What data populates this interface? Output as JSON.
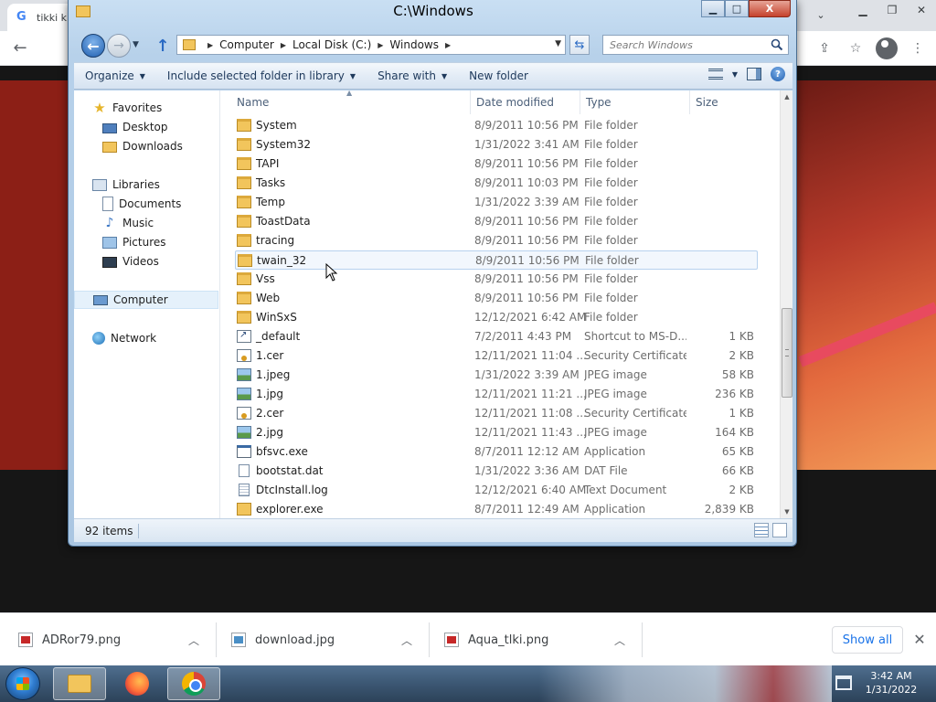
{
  "chrome": {
    "tabs": [
      {
        "title": "tikki k",
        "favicon": "google-g-icon",
        "active": true
      },
      {
        "title": "",
        "favicon": "green-square-icon",
        "active": false
      }
    ],
    "toolbar_icons": [
      "share-icon",
      "star-icon",
      "profile-avatar-icon",
      "menu-dots-icon"
    ]
  },
  "explorer": {
    "title": "C:\\Windows",
    "window_controls": {
      "minimize": "▁",
      "maximize": "□",
      "close": "X"
    },
    "breadcrumb": [
      "Computer",
      "Local Disk (C:)",
      "Windows"
    ],
    "search_placeholder": "Search Windows",
    "command_bar": {
      "organize": "Organize",
      "include_library": "Include selected folder in library",
      "share_with": "Share with",
      "new_folder": "New folder"
    },
    "nav_pane": {
      "favorites": {
        "label": "Favorites",
        "items": [
          "Desktop",
          "Downloads"
        ]
      },
      "libraries": {
        "label": "Libraries",
        "items": [
          "Documents",
          "Music",
          "Pictures",
          "Videos"
        ]
      },
      "computer": "Computer",
      "network": "Network"
    },
    "columns": {
      "name": "Name",
      "date": "Date modified",
      "type": "Type",
      "size": "Size"
    },
    "files": [
      {
        "name": "System",
        "date": "8/9/2011 10:56 PM",
        "type": "File folder",
        "size": "",
        "icon": "folder-icon"
      },
      {
        "name": "System32",
        "date": "1/31/2022 3:41 AM",
        "type": "File folder",
        "size": "",
        "icon": "folder-icon"
      },
      {
        "name": "TAPI",
        "date": "8/9/2011 10:56 PM",
        "type": "File folder",
        "size": "",
        "icon": "folder-icon"
      },
      {
        "name": "Tasks",
        "date": "8/9/2011 10:03 PM",
        "type": "File folder",
        "size": "",
        "icon": "folder-icon"
      },
      {
        "name": "Temp",
        "date": "1/31/2022 3:39 AM",
        "type": "File folder",
        "size": "",
        "icon": "folder-icon"
      },
      {
        "name": "ToastData",
        "date": "8/9/2011 10:56 PM",
        "type": "File folder",
        "size": "",
        "icon": "folder-icon"
      },
      {
        "name": "tracing",
        "date": "8/9/2011 10:56 PM",
        "type": "File folder",
        "size": "",
        "icon": "folder-icon"
      },
      {
        "name": "twain_32",
        "date": "8/9/2011 10:56 PM",
        "type": "File folder",
        "size": "",
        "icon": "folder-icon"
      },
      {
        "name": "Vss",
        "date": "8/9/2011 10:56 PM",
        "type": "File folder",
        "size": "",
        "icon": "folder-icon"
      },
      {
        "name": "Web",
        "date": "8/9/2011 10:56 PM",
        "type": "File folder",
        "size": "",
        "icon": "folder-icon"
      },
      {
        "name": "WinSxS",
        "date": "12/12/2021 6:42 AM",
        "type": "File folder",
        "size": "",
        "icon": "folder-icon"
      },
      {
        "name": "_default",
        "date": "7/2/2011 4:43 PM",
        "type": "Shortcut to MS-D...",
        "size": "1 KB",
        "icon": "shortcut-icon"
      },
      {
        "name": "1.cer",
        "date": "12/11/2021 11:04 ...",
        "type": "Security Certificate",
        "size": "2 KB",
        "icon": "certificate-icon"
      },
      {
        "name": "1.jpeg",
        "date": "1/31/2022 3:39 AM",
        "type": "JPEG image",
        "size": "58 KB",
        "icon": "image-icon"
      },
      {
        "name": "1.jpg",
        "date": "12/11/2021 11:21 ...",
        "type": "JPEG image",
        "size": "236 KB",
        "icon": "image-icon"
      },
      {
        "name": "2.cer",
        "date": "12/11/2021 11:08 ...",
        "type": "Security Certificate",
        "size": "1 KB",
        "icon": "certificate-icon"
      },
      {
        "name": "2.jpg",
        "date": "12/11/2021 11:43 ...",
        "type": "JPEG image",
        "size": "164 KB",
        "icon": "image-icon"
      },
      {
        "name": "bfsvc.exe",
        "date": "8/7/2011 12:12 AM",
        "type": "Application",
        "size": "65 KB",
        "icon": "application-icon"
      },
      {
        "name": "bootstat.dat",
        "date": "1/31/2022 3:36 AM",
        "type": "DAT File",
        "size": "66 KB",
        "icon": "document-icon"
      },
      {
        "name": "DtcInstall.log",
        "date": "12/12/2021 6:40 AM",
        "type": "Text Document",
        "size": "2 KB",
        "icon": "text-document-icon"
      },
      {
        "name": "explorer.exe",
        "date": "8/7/2011 12:49 AM",
        "type": "Application",
        "size": "2,839 KB",
        "icon": "explorer-app-icon"
      }
    ],
    "hovered_file": "twain_32",
    "status": {
      "item_count": "92 items"
    }
  },
  "downloads": {
    "items": [
      {
        "name": "ADRor79.png",
        "icon": "png-file-icon"
      },
      {
        "name": "download.jpg",
        "icon": "jpg-file-icon"
      },
      {
        "name": "Aqua_tlki.png",
        "icon": "png-file-icon"
      }
    ],
    "show_all": "Show all"
  },
  "taskbar": {
    "clock_time": "3:42 AM",
    "clock_date": "1/31/2022"
  }
}
